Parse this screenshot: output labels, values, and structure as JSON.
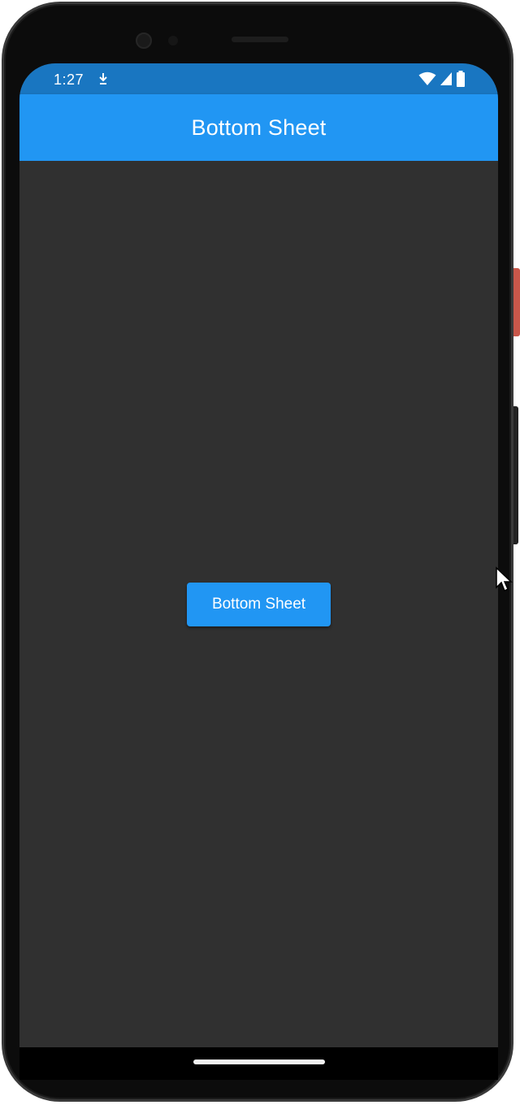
{
  "status_bar": {
    "time": "1:27",
    "notification_icon": "download-icon",
    "icons": [
      "wifi-icon",
      "signal-icon",
      "battery-icon"
    ],
    "color": "#1976c1"
  },
  "app_bar": {
    "title": "Bottom Sheet",
    "color": "#2196f3"
  },
  "main": {
    "button_label": "Bottom Sheet",
    "background": "#303030"
  },
  "nav_bar": {
    "gesture_handle": "home-indicator"
  }
}
